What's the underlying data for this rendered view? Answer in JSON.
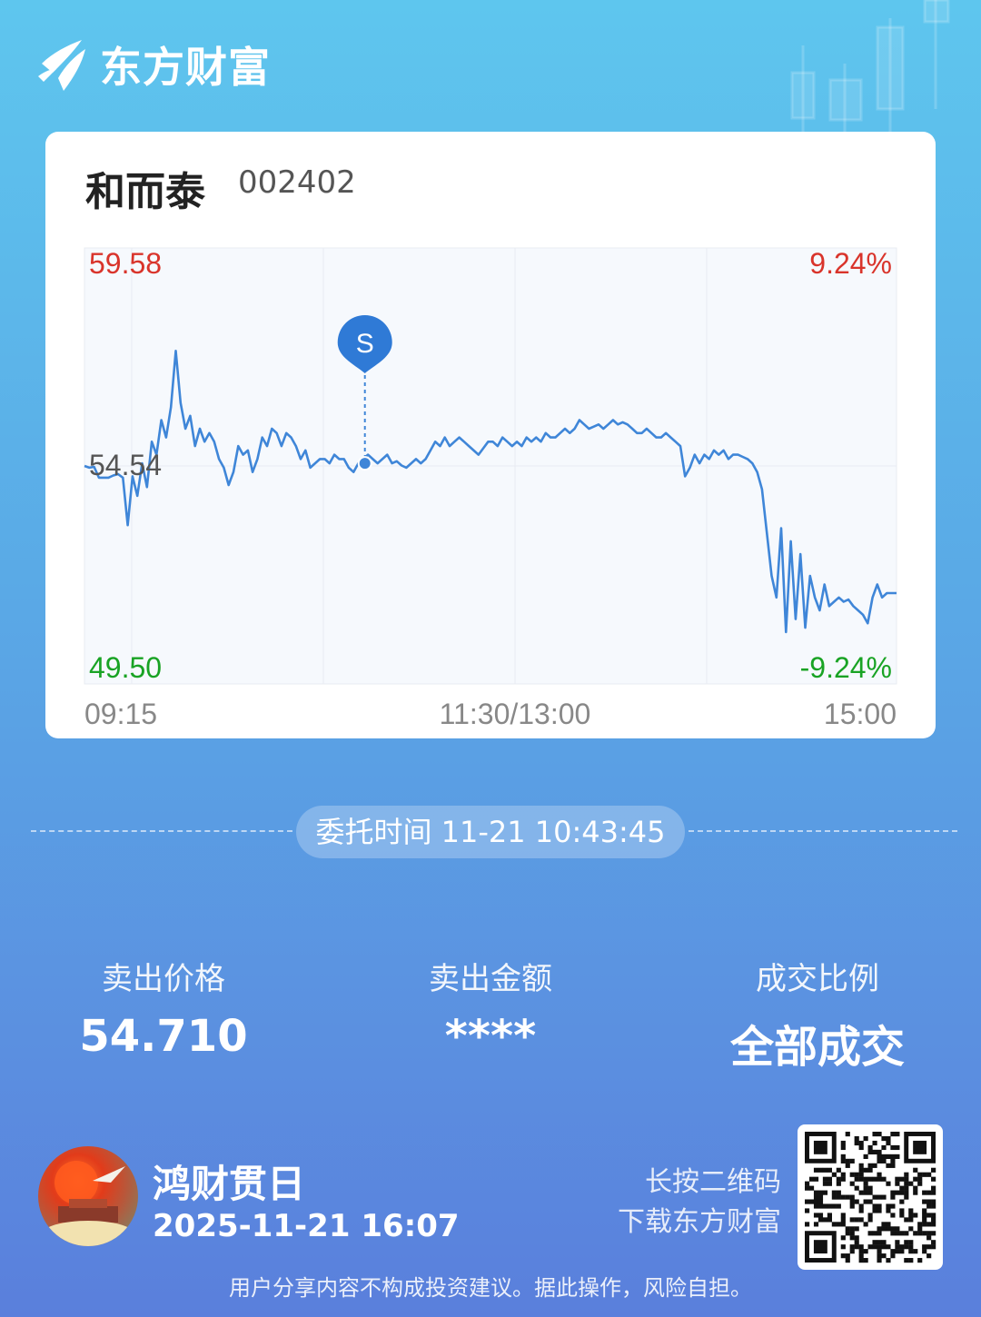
{
  "brand": {
    "name": "东方财富"
  },
  "stock": {
    "name": "和而泰",
    "code": "002402"
  },
  "chart_data": {
    "type": "line",
    "y_labels": {
      "high": "59.58",
      "mid": "54.54",
      "low": "49.50"
    },
    "pct_labels": {
      "high": "9.24%",
      "low": "-9.24%"
    },
    "x_labels": [
      "09:15",
      "11:30/13:00",
      "15:00"
    ],
    "ylim": [
      49.5,
      59.58
    ],
    "prev_close": 54.54,
    "marker": {
      "label": "S",
      "time": "10:43",
      "price": 54.6
    },
    "series": [
      {
        "values": [
          54.54,
          54.5,
          54.52,
          54.27,
          54.27,
          54.27,
          54.32,
          54.35,
          54.27,
          53.17,
          54.3,
          53.85,
          54.6,
          54.05,
          55.1,
          54.8,
          55.6,
          55.2,
          55.9,
          57.2,
          56.0,
          55.4,
          55.7,
          55.0,
          55.4,
          55.1,
          55.3,
          55.1,
          54.7,
          54.5,
          54.1,
          54.4,
          55.0,
          54.8,
          54.9,
          54.4,
          54.7,
          55.2,
          55.0,
          55.4,
          55.3,
          55.0,
          55.3,
          55.2,
          55.0,
          54.7,
          54.9,
          54.5,
          54.6,
          54.7,
          54.7,
          54.6,
          54.8,
          54.7,
          54.7,
          54.5,
          54.4,
          54.6,
          54.7,
          54.8,
          54.7,
          54.6,
          54.7,
          54.8,
          54.6,
          54.65,
          54.55,
          54.5,
          54.6,
          54.7,
          54.6,
          54.7,
          54.9,
          55.1,
          55.0,
          55.2,
          55.0,
          55.1,
          55.2,
          55.1,
          55.0,
          54.9,
          54.8,
          54.95,
          55.1,
          55.1,
          55.0,
          55.2,
          55.1,
          55.0,
          55.1,
          55.0,
          55.2,
          55.1,
          55.2,
          55.1,
          55.3,
          55.2,
          55.2,
          55.3,
          55.4,
          55.3,
          55.4,
          55.6,
          55.5,
          55.4,
          55.45,
          55.5,
          55.4,
          55.5,
          55.6,
          55.5,
          55.55,
          55.5,
          55.4,
          55.3,
          55.3,
          55.4,
          55.3,
          55.2,
          55.2,
          55.3,
          55.2,
          55.1,
          55.0,
          54.3,
          54.5,
          54.8,
          54.6,
          54.8,
          54.7,
          54.9,
          54.8,
          54.9,
          54.7,
          54.8,
          54.8,
          54.75,
          54.7,
          54.6,
          54.4,
          54.0,
          53.0,
          52.0,
          51.5,
          53.1,
          50.7,
          52.8,
          51.0,
          52.5,
          50.8,
          52.0,
          51.5,
          51.2,
          51.8,
          51.3,
          51.4,
          51.5,
          51.4,
          51.45,
          51.3,
          51.2,
          51.1,
          50.9,
          51.5,
          51.8,
          51.5,
          51.6,
          51.6,
          51.6
        ]
      }
    ]
  },
  "order": {
    "label": "委托时间 11-21 10:43:45"
  },
  "stats": [
    {
      "label": "卖出价格",
      "value": "54.710"
    },
    {
      "label": "卖出金额",
      "value": "****"
    },
    {
      "label": "成交比例",
      "value": "全部成交"
    }
  ],
  "user": {
    "name": "鸿财贯日",
    "time": "2025-11-21 16:07"
  },
  "qr_hint": {
    "line1": "长按二维码",
    "line2": "下载东方财富"
  },
  "disclaimer": "用户分享内容不构成投资建议。据此操作，风险自担。",
  "colors": {
    "up": "#d9342b",
    "down": "#19a324",
    "line": "#3f86d8"
  }
}
